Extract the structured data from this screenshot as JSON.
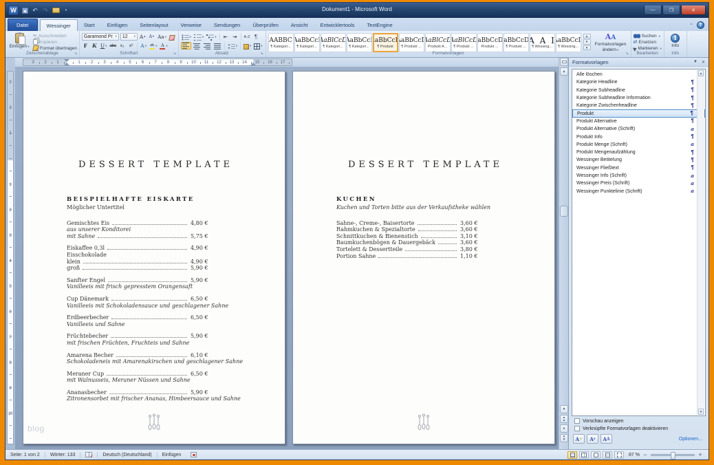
{
  "window": {
    "title": "Dokument1 - Microsoft Word"
  },
  "tabs": [
    {
      "label": "Datei",
      "kind": "file"
    },
    {
      "label": "Wessinger",
      "active": true
    },
    {
      "label": "Start"
    },
    {
      "label": "Einfügen"
    },
    {
      "label": "Seitenlayout"
    },
    {
      "label": "Verweise"
    },
    {
      "label": "Sendungen"
    },
    {
      "label": "Überprüfen"
    },
    {
      "label": "Ansicht"
    },
    {
      "label": "Entwicklertools"
    },
    {
      "label": "TextEngine"
    }
  ],
  "ribbon": {
    "clipboard": {
      "label": "Zwischenablage",
      "paste_label": "Einfügen",
      "cut": "Ausschneiden",
      "copy": "Kopieren",
      "painter": "Format übertragen"
    },
    "font": {
      "label": "Schriftart",
      "family": "Garamond Pr",
      "size": "12"
    },
    "paragraph": {
      "label": "Absatz"
    },
    "styles": {
      "label": "Formatvorlagen",
      "change": "Formatvorlagen ändern",
      "gallery": [
        {
          "sample": "AABBC",
          "label": "¶ Kategori..."
        },
        {
          "sample": "AaBbCcI",
          "label": "¶ Kategori..."
        },
        {
          "sample": "AaBlCcD",
          "label": "¶ Kategori...",
          "italic": true
        },
        {
          "sample": "AaBbCcI",
          "label": "¶ Kategori..."
        },
        {
          "sample": "AaBbCcD",
          "label": "¶ Produkt",
          "selected": true
        },
        {
          "sample": "AaBbCcD",
          "label": "¶ Produkt ..."
        },
        {
          "sample": "AaBlCcD",
          "label": "Produkt A...",
          "italic": true
        },
        {
          "sample": "AaBlCcD",
          "label": "¶ Produkt ...",
          "italic": true
        },
        {
          "sample": "AaBbCcDc",
          "label": "Produkt ..."
        },
        {
          "sample": "AaBbCcDc",
          "label": "¶ Produkt ..."
        },
        {
          "sample": "A A I",
          "label": "¶ Wessing...",
          "big": true
        },
        {
          "sample": "AaBbCcD",
          "label": "¶ Wessing..."
        }
      ]
    },
    "editing": {
      "label": "Bearbeiten",
      "find": "Suchen",
      "replace": "Ersetzen",
      "select": "Markieren"
    },
    "info": {
      "label": "Info",
      "button": "Info"
    }
  },
  "ruler": {
    "h_margin": [
      "3",
      "2",
      "1"
    ],
    "h": [
      "1",
      "2",
      "3",
      "4",
      "5",
      "6",
      "7",
      "8",
      "9",
      "10",
      "11",
      "12",
      "13",
      "14",
      "15",
      "16",
      "17"
    ],
    "v_top": [
      "3",
      "2",
      "1"
    ],
    "v": [
      "1",
      "2",
      "3",
      "4",
      "5",
      "6",
      "7",
      "8",
      "9",
      "10"
    ]
  },
  "styles_panel": {
    "title": "Formatvorlagen",
    "items": [
      {
        "label": "Alle löschen",
        "marker": ""
      },
      {
        "label": "Kategorie Headline",
        "marker": "¶"
      },
      {
        "label": "Kategorie Subheadline",
        "marker": "¶"
      },
      {
        "label": "Kategorie Subheadline Information",
        "marker": "¶"
      },
      {
        "label": "Kategorie Zwischenheadline",
        "marker": "¶"
      },
      {
        "label": "Produkt",
        "marker": "¶",
        "selected": true
      },
      {
        "label": "Produkt Alternative",
        "marker": "¶"
      },
      {
        "label": "Produkt Alternative (Schrift)",
        "marker": "a"
      },
      {
        "label": "Produkt Info",
        "marker": "¶"
      },
      {
        "label": "Produkt Menge (Schrift)",
        "marker": "a"
      },
      {
        "label": "Produkt Mengenaufzählung",
        "marker": "¶"
      },
      {
        "label": "Wessinger Betitelung",
        "marker": "¶"
      },
      {
        "label": "Wessinger Fließtext",
        "marker": "¶"
      },
      {
        "label": "Wessinger Info (Schrift)",
        "marker": "a"
      },
      {
        "label": "Wessinger Preis (Schrift)",
        "marker": "a"
      },
      {
        "label": "Wessinger Punktelinie (Schrift)",
        "marker": "a"
      }
    ],
    "preview_checkbox": "Vorschau anzeigen",
    "linked_checkbox": "Verknüpfte Formatvorlagen deaktivieren",
    "options_link": "Optionen..."
  },
  "document": {
    "pages": [
      {
        "title": "DESSERT TEMPLATE",
        "category": "BEISPIELHAFTE EISKARTE",
        "subtitle": "Möglicher Untertitel",
        "subtitle_italic": false,
        "watermark": "blog",
        "groups": [
          {
            "lines": [
              {
                "text": "Gemischtes Eis",
                "price": "4,80 €"
              },
              {
                "text": "aus unserer Konditorei",
                "style": "info"
              },
              {
                "text": "mit Sahne",
                "price": "5,75 €",
                "style": "info"
              }
            ]
          },
          {
            "lines": [
              {
                "text": "Eiskaffee 0,3l",
                "price": "4,90 €"
              },
              {
                "text": "Eisschokolade"
              },
              {
                "text": "klein",
                "price": "4,90 €"
              },
              {
                "text": "groß",
                "price": "5,90 €"
              }
            ]
          },
          {
            "lines": [
              {
                "text": "Sanfter Engel",
                "price": "5,90 €"
              },
              {
                "text": "Vanilleeis mit frisch gepresstem Orangensaft",
                "style": "info"
              }
            ]
          },
          {
            "lines": [
              {
                "text": "Cup Dänemark",
                "price": "6,50 €"
              },
              {
                "text": "Vanilleeis mit Schokoladensauce und geschlagener Sahne",
                "style": "info"
              }
            ]
          },
          {
            "lines": [
              {
                "text": "Erdbeerbecher",
                "price": "6,50 €"
              },
              {
                "text": "Vanilleeis und Sahne",
                "style": "info"
              }
            ]
          },
          {
            "lines": [
              {
                "text": "Früchtebecher",
                "price": "5,90 €"
              },
              {
                "text": "mit frischen Früchten, Fruchteis und Sahne",
                "style": "info"
              }
            ]
          },
          {
            "lines": [
              {
                "text": "Amarena Becher",
                "price": "6,10 €"
              },
              {
                "text": "Schokoladeneis mit Amarenakirschen und geschlagener Sahne",
                "style": "info"
              }
            ]
          },
          {
            "lines": [
              {
                "text": "Meraner Cup",
                "price": "6,50 €"
              },
              {
                "text": "mit Walnusseis, Meraner Nüssen und Sahne",
                "style": "info"
              }
            ]
          },
          {
            "lines": [
              {
                "text": "Ananasbecher",
                "price": "5,90 €"
              },
              {
                "text": "Zitronensorbet mit frischer Ananas, Himbeersauce und Sahne",
                "style": "info"
              }
            ]
          }
        ]
      },
      {
        "title": "DESSERT TEMPLATE",
        "category": "KUCHEN",
        "subtitle": "Kuchen und Torten bitte aus der Verkaufstheke wählen",
        "subtitle_italic": true,
        "groups": [
          {
            "lines": [
              {
                "text": "Sahne-, Creme-, Baisertorte",
                "price": "3,60 €"
              },
              {
                "text": "Rahmkuchen & Spezialtorte",
                "price": "3,60 €"
              },
              {
                "text": "Schnittkuchen & Bienenstich",
                "price": "3,10 €"
              },
              {
                "text": "Baumkuchenbögen & Dauergebäck",
                "price": "3,60 €"
              },
              {
                "text": "Tortelett & Dessertteile",
                "price": "3,80 €"
              },
              {
                "text": "Portion Sahne",
                "price": "1,10 €"
              }
            ]
          }
        ]
      }
    ]
  },
  "status_bar": {
    "page": "Seite: 1 von 2",
    "words": "Wörter: 133",
    "language": "Deutsch (Deutschland)",
    "mode": "Einfügen",
    "zoom": "87 %"
  },
  "colors": {
    "desktop_orange": "#EF8A00",
    "titlebar_blue": "#24466F",
    "gallery_selected_border": "#E8A33D",
    "selection_blue": "#4E8CC8",
    "style_marker_blue": "#283593",
    "link_blue": "#1B66C9"
  }
}
